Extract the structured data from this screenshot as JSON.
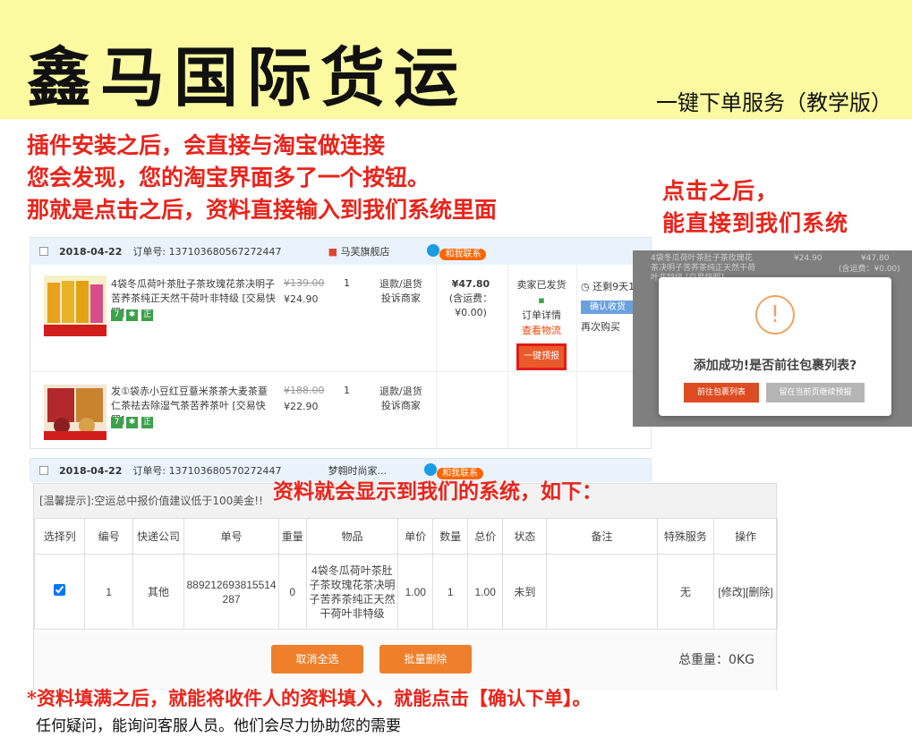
{
  "header": {
    "brand": "鑫马国际货运",
    "subtitle": "一键下单服务（教学版）"
  },
  "notes": {
    "intro_lines": [
      "插件安装之后，会直接与淘宝做连接",
      "您会发现，您的淘宝界面多了一个按钮。",
      "那就是点击之后，资料直接输入到我们系统里面"
    ],
    "after_click_lines": [
      "点击之后，",
      "能直接到我们系统"
    ],
    "display_note": "资料就会显示到我们的系统，如下：",
    "footnote": "*资料填满之后，就能将收件人的资料填入，就能点击【确认下单】。",
    "footnote2": "任何疑问，能询问客服人员。他们会尽力协助您的需要"
  },
  "order1": {
    "date": "2018-04-22",
    "order_no": "订单号: 137103680567272447",
    "shop": "马芙旗舰店",
    "contact": "和我联系",
    "items": [
      {
        "title": "4袋冬瓜荷叶茶肚子茶玫瑰花茶决明子苦荞茶纯正天然干荷叶非特级 [交易快照]",
        "orig_price": "¥139.00",
        "price": "¥24.90",
        "qty": "1",
        "svc1": "退款/退货",
        "svc2": "投诉商家"
      },
      {
        "title": "发①袋赤小豆红豆薏米茶茶大麦茶薏仁茶祛去除湿气茶苦荞茶叶 [交易快照]",
        "orig_price": "¥188.00",
        "price": "¥22.90",
        "qty": "1",
        "svc1": "退款/退货",
        "svc2": "投诉商家"
      }
    ],
    "total": "¥47.80",
    "shipping": "(含运费：¥0.00)",
    "status_lines": [
      "卖家已发货",
      "订单详情"
    ],
    "view_logistics": "查看物流",
    "one_click": "一键预报",
    "countdown": "还剩9天1",
    "confirm_receipt": "确认收货",
    "rebuy": "再次购买"
  },
  "order2": {
    "date": "2018-04-22",
    "order_no": "订单号: 137103680570272447",
    "shop": "梦翱时尚家..."
  },
  "dialog": {
    "icon": "!",
    "message": "添加成功!是否前往包裹列表?",
    "go_btn": "前往包裹列表",
    "stay_btn": "留在当前页继续预报"
  },
  "system": {
    "tip": "[温馨提示]:空运总中报价值建议低于100美金!!",
    "columns": [
      "选择列",
      "编号",
      "快递公司",
      "单号",
      "重量",
      "物品",
      "单价",
      "数量",
      "总价",
      "状态",
      "备注",
      "特殊服务",
      "操作"
    ],
    "row": {
      "id": "1",
      "courier": "其他",
      "tracking": "889212693815514287",
      "weight": "0",
      "goods": "4袋冬瓜荷叶茶肚子茶玫瑰花茶决明子苦荞茶纯正天然干荷叶非特级",
      "unit_price": "1.00",
      "qty": "1",
      "total": "1.00",
      "status": "未到",
      "remark": "",
      "special": "无",
      "ops": "[修改][删除]"
    },
    "cancel_all": "取消全选",
    "batch_delete": "批量删除",
    "total_weight": "总重量：0KG"
  },
  "colors": {
    "banner": "#fbfaa0",
    "note_red": "#e8241b",
    "orange": "#ef7f2b"
  }
}
